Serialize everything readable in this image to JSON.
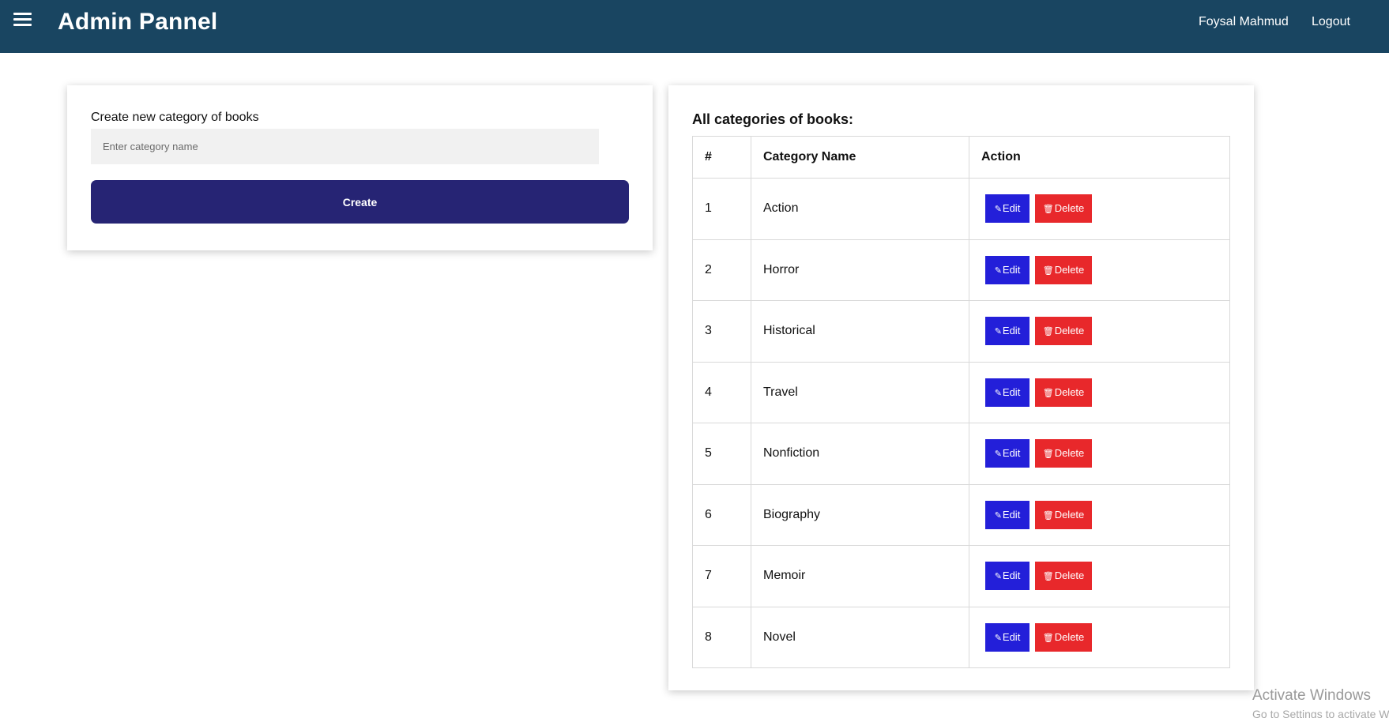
{
  "header": {
    "title": "Admin Pannel",
    "menu_icon": "hamburger-menu-icon",
    "user_name": "Foysal Mahmud",
    "logout_label": "Logout",
    "background": "#194561"
  },
  "create_form": {
    "label": "Create new category of books",
    "input_placeholder": "Enter category name",
    "input_value": "",
    "button_label": "Create",
    "button_color": "#262474"
  },
  "categories_table": {
    "title": "All categories of books:",
    "columns": [
      "#",
      "Category Name",
      "Action"
    ],
    "rows": [
      {
        "num": "1",
        "name": "Action"
      },
      {
        "num": "2",
        "name": "Horror"
      },
      {
        "num": "3",
        "name": "Historical"
      },
      {
        "num": "4",
        "name": "Travel"
      },
      {
        "num": "5",
        "name": "Nonfiction"
      },
      {
        "num": "6",
        "name": "Biography"
      },
      {
        "num": "7",
        "name": "Memoir"
      },
      {
        "num": "8",
        "name": "Novel"
      }
    ],
    "edit_label": "Edit",
    "delete_label": "Delete",
    "edit_icon": "edit-icon",
    "delete_icon": "trash-icon",
    "edit_color": "#231fd9",
    "delete_color": "#e8282b"
  },
  "watermark": {
    "title": "Activate Windows",
    "subtitle": "Go to Settings to activate Windows."
  }
}
